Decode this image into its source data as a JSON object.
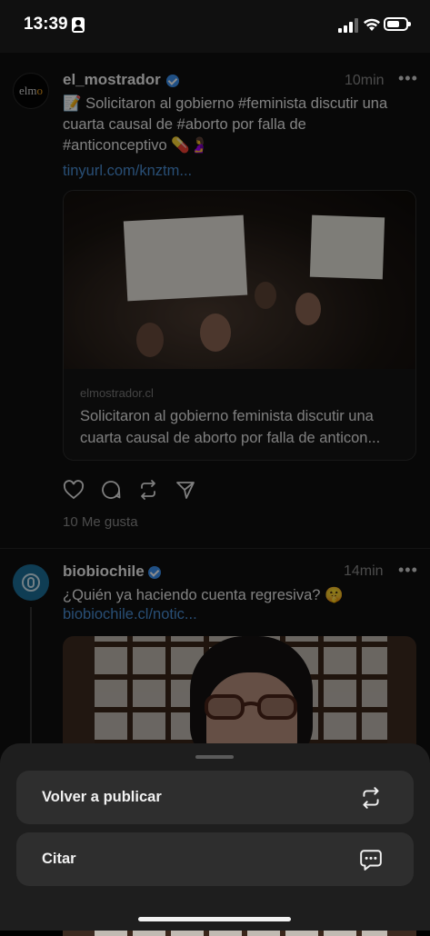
{
  "status_bar": {
    "time": "13:39"
  },
  "posts": [
    {
      "username": "el_mostrador",
      "avatar_text": "elm",
      "avatar_accent": "o",
      "time_ago": "10min",
      "text_line1": "📝 Solicitaron al gobierno #feminista discutir una",
      "text_line2": "cuarta causal de #aborto por falla de",
      "text_line3": "#anticonceptivo 💊🤰",
      "link": "tinyurl.com/knztm...",
      "card": {
        "domain": "elmostrador.cl",
        "title": "Solicitaron al gobierno feminista discutir una cuarta causal de aborto por falla de anticon..."
      },
      "likes": "10 Me gusta"
    },
    {
      "username": "biobiochile",
      "time_ago": "14min",
      "text": "¿Quién ya haciendo cuenta regresiva? 🤫",
      "link": "biobiochile.cl/notic..."
    }
  ],
  "sheet": {
    "repost_label": "Volver a publicar",
    "quote_label": "Citar"
  },
  "colors": {
    "verified": "#3b93f3",
    "link": "#4a8fd6",
    "sheet": "#1e1e1e"
  }
}
